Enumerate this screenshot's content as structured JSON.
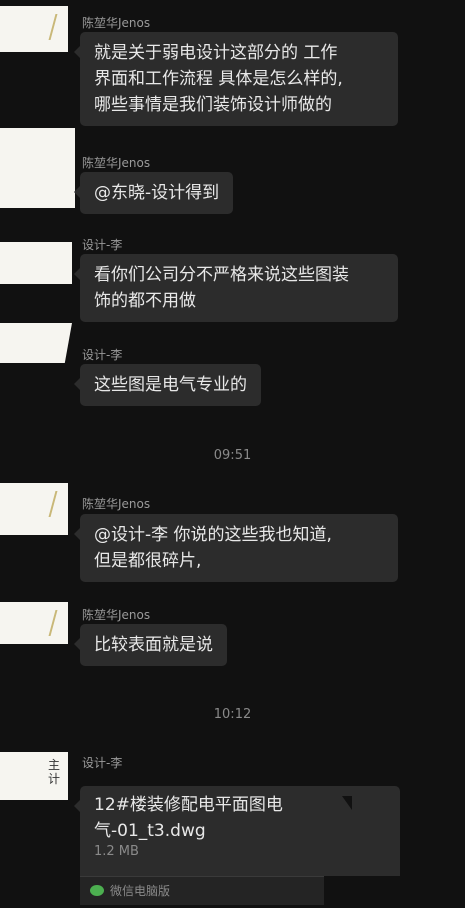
{
  "messages": [
    {
      "sender": "陈堃华Jenos",
      "lines": [
        "就是关于弱电设计这部分的 工作",
        "界面和工作流程 具体是怎么样的,",
        "哪些事情是我们装饰设计师做的"
      ]
    },
    {
      "sender": "陈堃华Jenos",
      "lines": [
        "@东晓-设计得到"
      ]
    },
    {
      "sender": "设计-李",
      "lines": [
        "看你们公司分不严格来说这些图装",
        "饰的都不用做"
      ]
    },
    {
      "sender": "设计-李",
      "lines": [
        "这些图是电气专业的"
      ]
    },
    {
      "sender": "陈堃华Jenos",
      "lines": [
        "@设计-李  你说的这些我也知道,",
        "但是都很碎片,"
      ]
    },
    {
      "sender": "陈堃华Jenos",
      "lines": [
        "比较表面就是说"
      ]
    },
    {
      "sender": "设计-李"
    }
  ],
  "timestamps": [
    "09:51",
    "10:12"
  ],
  "avatar_text": "主\n计",
  "file": {
    "name": "12#楼装修配电平面图电气-01_t3.dwg",
    "size": "1.2 MB",
    "source": "微信电脑版",
    "source_icon": "wechat-icon"
  }
}
